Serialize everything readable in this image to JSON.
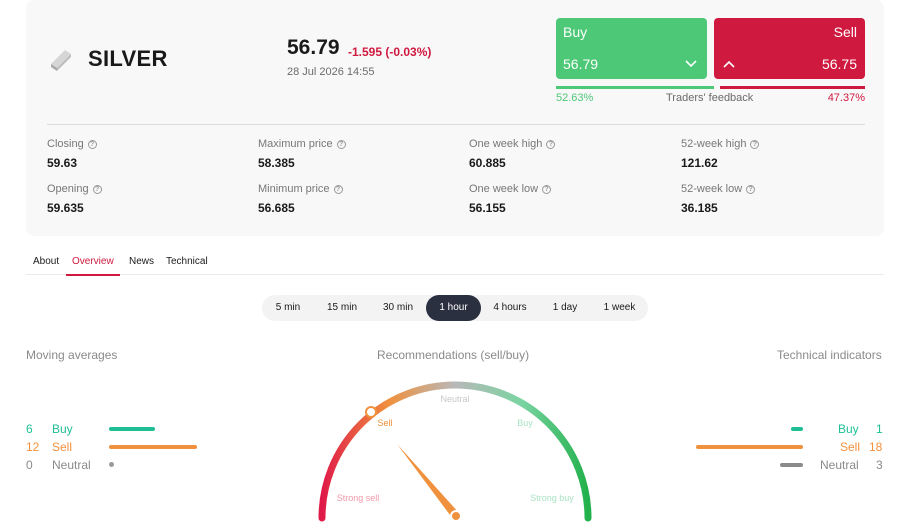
{
  "instrument": {
    "name": "SILVER",
    "logo": "silver-bar-icon",
    "price": "56.79",
    "change": "-1.595 (-0.03%)",
    "datetime": "28 Jul 2026 14:55"
  },
  "trade": {
    "buy": {
      "label": "Buy",
      "price": "56.79",
      "color": "#4cc877"
    },
    "sell": {
      "label": "Sell",
      "price": "56.75",
      "color": "#d0193f"
    },
    "feedback": {
      "buy_pct": "52.63%",
      "label": "Traders' feedback",
      "sell_pct": "47.37%",
      "buy_fraction": 0.5263
    }
  },
  "stats": [
    {
      "label": "Closing",
      "value": "59.63"
    },
    {
      "label": "Maximum price",
      "value": "58.385"
    },
    {
      "label": "One week high",
      "value": "60.885"
    },
    {
      "label": "52-week high",
      "value": "121.62"
    },
    {
      "label": "Opening",
      "value": "59.635"
    },
    {
      "label": "Minimum price",
      "value": "56.685"
    },
    {
      "label": "One week low",
      "value": "56.155"
    },
    {
      "label": "52-week low",
      "value": "36.185"
    }
  ],
  "tabs": [
    {
      "label": "About"
    },
    {
      "label": "Overview",
      "active": true
    },
    {
      "label": "News"
    },
    {
      "label": "Technical"
    }
  ],
  "timeframes": [
    {
      "label": "5 min"
    },
    {
      "label": "15 min"
    },
    {
      "label": "30 min"
    },
    {
      "label": "1 hour",
      "active": true
    },
    {
      "label": "4 hours"
    },
    {
      "label": "1 day"
    },
    {
      "label": "1 week"
    }
  ],
  "moving_averages": {
    "title": "Moving averages",
    "rows": [
      {
        "count": "6",
        "label": "Buy",
        "color": "#1fbf95"
      },
      {
        "count": "12",
        "label": "Sell",
        "color": "#f0913d"
      },
      {
        "count": "0",
        "label": "Neutral",
        "color": "#8a8a8a"
      }
    ]
  },
  "recommendation": {
    "title": "Recommendations (sell/buy)",
    "labels": {
      "strong_sell": "Strong sell",
      "sell": "Sell",
      "neutral": "Neutral",
      "buy": "Buy",
      "strong_buy": "Strong buy"
    },
    "current": "Sell"
  },
  "technical_indicators": {
    "title": "Technical indicators",
    "rows": [
      {
        "count": "1",
        "label": "Buy",
        "color": "#1fbf95"
      },
      {
        "count": "18",
        "label": "Sell",
        "color": "#f0913d"
      },
      {
        "count": "3",
        "label": "Neutral",
        "color": "#8a8a8a"
      }
    ]
  }
}
